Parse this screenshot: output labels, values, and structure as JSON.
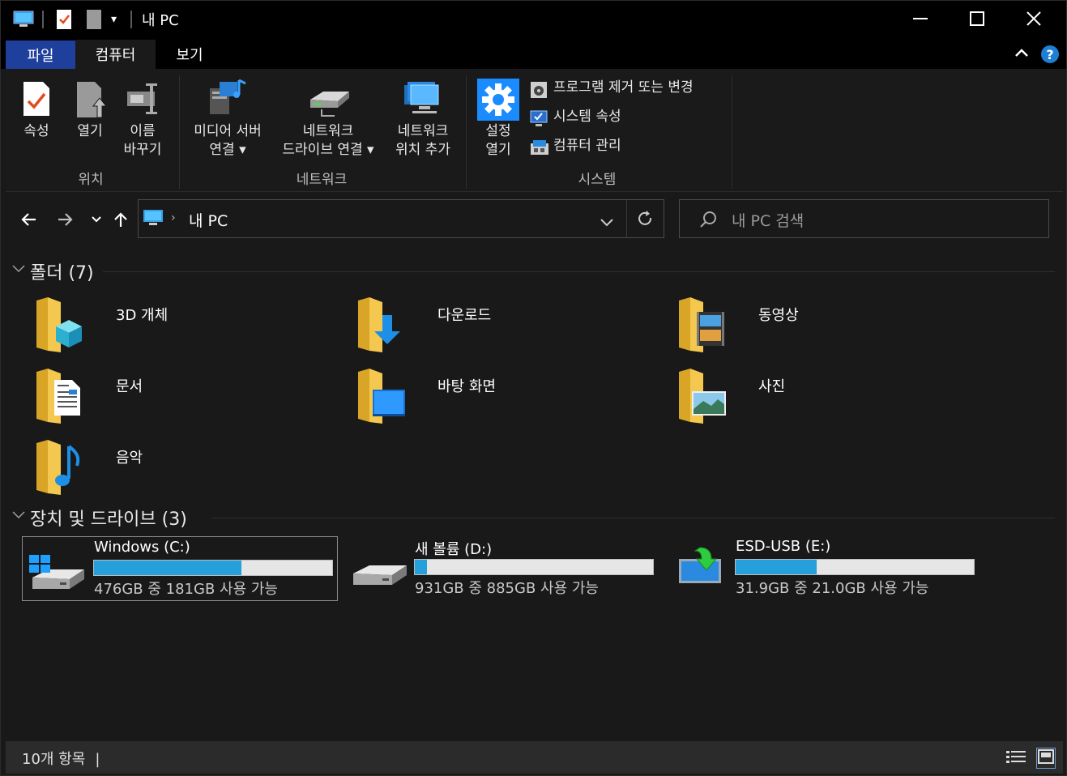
{
  "window": {
    "title": "내 PC"
  },
  "tabs": {
    "file": "파일",
    "computer": "컴퓨터",
    "view": "보기"
  },
  "ribbon": {
    "location": {
      "label": "위치",
      "properties": "속성",
      "open": "열기",
      "rename_line1": "이름",
      "rename_line2": "바꾸기"
    },
    "network": {
      "label": "네트워크",
      "media_server_line1": "미디어 서버",
      "media_server_line2": "연결 ▾",
      "map_drive_line1": "네트워크",
      "map_drive_line2": "드라이브 연결 ▾",
      "add_location_line1": "네트워크",
      "add_location_line2": "위치 추가"
    },
    "system": {
      "label": "시스템",
      "open_settings_line1": "설정",
      "open_settings_line2": "열기",
      "uninstall": "프로그램 제거 또는 변경",
      "system_properties": "시스템 속성",
      "manage": "컴퓨터 관리"
    }
  },
  "address": {
    "path": "내 PC",
    "search_placeholder": "내 PC 검색"
  },
  "folders": {
    "header": "폴더 (7)",
    "items": [
      "3D 개체",
      "다운로드",
      "동영상",
      "문서",
      "바탕 화면",
      "사진",
      "음악"
    ]
  },
  "drives": {
    "header": "장치 및 드라이브 (3)",
    "items": [
      {
        "name": "Windows (C:)",
        "info": "476GB 중 181GB 사용 가능",
        "used_fraction": 0.62
      },
      {
        "name": "새 볼륨 (D:)",
        "info": "931GB 중 885GB 사용 가능",
        "used_fraction": 0.05
      },
      {
        "name": "ESD-USB (E:)",
        "info": "31.9GB 중 21.0GB 사용 가능",
        "used_fraction": 0.34
      }
    ]
  },
  "status": {
    "count": "10개 항목"
  },
  "colors": {
    "accent": "#26a0da",
    "file_tab": "#1f3f9c",
    "folder": "#f4c84e"
  }
}
